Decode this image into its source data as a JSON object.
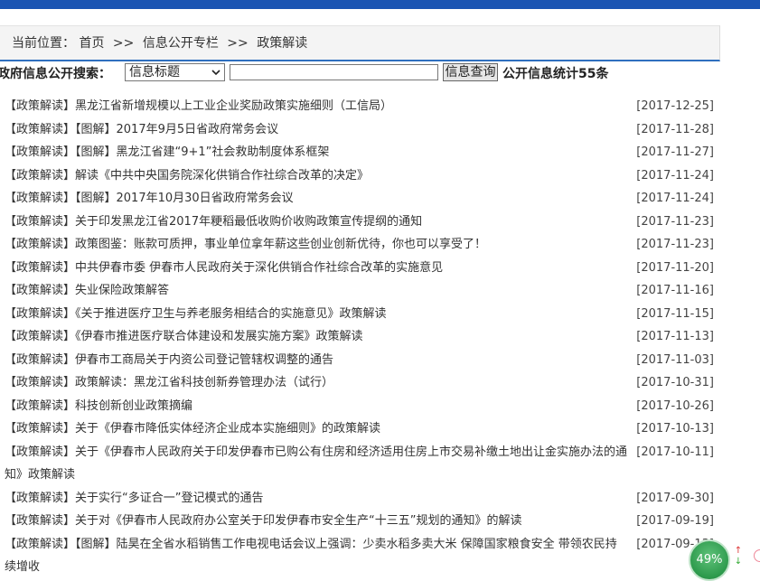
{
  "breadcrumb": {
    "prefix": "当前位置：",
    "home": "首页",
    "sep1": ">>",
    "section": "信息公开专栏",
    "sep2": ">>",
    "current": "政策解读"
  },
  "search": {
    "label": "政府信息公开搜索：",
    "select_value": "信息标题",
    "input_value": "",
    "button_label": "信息查询",
    "stats": "公开信息统计55条"
  },
  "items": [
    {
      "title": "【政策解读】黑龙江省新增规模以上工业企业奖励政策实施细则（工信局）",
      "date": "[2017-12-25]"
    },
    {
      "title": "【政策解读】【图解】2017年9月5日省政府常务会议",
      "date": "[2017-11-28]"
    },
    {
      "title": "【政策解读】【图解】黑龙江省建“9+1”社会救助制度体系框架",
      "date": "[2017-11-27]"
    },
    {
      "title": "【政策解读】解读《中共中央国务院深化供销合作社综合改革的决定》",
      "date": "[2017-11-24]"
    },
    {
      "title": "【政策解读】【图解】2017年10月30日省政府常务会议",
      "date": "[2017-11-24]"
    },
    {
      "title": "【政策解读】关于印发黑龙江省2017年粳稻最低收购价收购政策宣传提纲的通知",
      "date": "[2017-11-23]"
    },
    {
      "title": "【政策解读】政策图鉴：账款可质押，事业单位拿年薪这些创业创新优待，你也可以享受了！",
      "date": "[2017-11-23]"
    },
    {
      "title": "【政策解读】中共伊春市委 伊春市人民政府关于深化供销合作社综合改革的实施意见",
      "date": "[2017-11-20]"
    },
    {
      "title": "【政策解读】失业保险政策解答",
      "date": "[2017-11-16]"
    },
    {
      "title": "【政策解读】《关于推进医疗卫生与养老服务相结合的实施意见》政策解读",
      "date": "[2017-11-15]"
    },
    {
      "title": "【政策解读】《伊春市推进医疗联合体建设和发展实施方案》政策解读",
      "date": "[2017-11-13]"
    },
    {
      "title": "【政策解读】伊春市工商局关于内资公司登记管辖权调整的通告",
      "date": "[2017-11-03]"
    },
    {
      "title": "【政策解读】政策解读：黑龙江省科技创新券管理办法（试行）",
      "date": "[2017-10-31]"
    },
    {
      "title": "【政策解读】科技创新创业政策摘编",
      "date": "[2017-10-26]"
    },
    {
      "title": "【政策解读】关于《伊春市降低实体经济企业成本实施细则》的政策解读",
      "date": "[2017-10-13]"
    },
    {
      "title": "【政策解读】关于《伊春市人民政府关于印发伊春市已购公有住房和经济适用住房上市交易补缴土地出让金实施办法的通知》政策解读",
      "date": "[2017-10-11]"
    },
    {
      "title": "【政策解读】关于实行“多证合一”登记模式的通告",
      "date": "[2017-09-30]"
    },
    {
      "title": "【政策解读】关于对《伊春市人民政府办公室关于印发伊春市安全生产“十三五”规划的通知》的解读",
      "date": "[2017-09-19]"
    },
    {
      "title": "【政策解读】【图解】陆昊在全省水稻销售工作电视电话会议上强调：少卖水稻多卖大米 保障国家粮食安全 带领农民持续增收",
      "date": "[2017-09-13]"
    }
  ],
  "widget": {
    "percent": "49%"
  },
  "colors": {
    "top_bar": "#1a55b3",
    "accent_line": "#2f6fbf",
    "badge": "#2d9a4c"
  }
}
